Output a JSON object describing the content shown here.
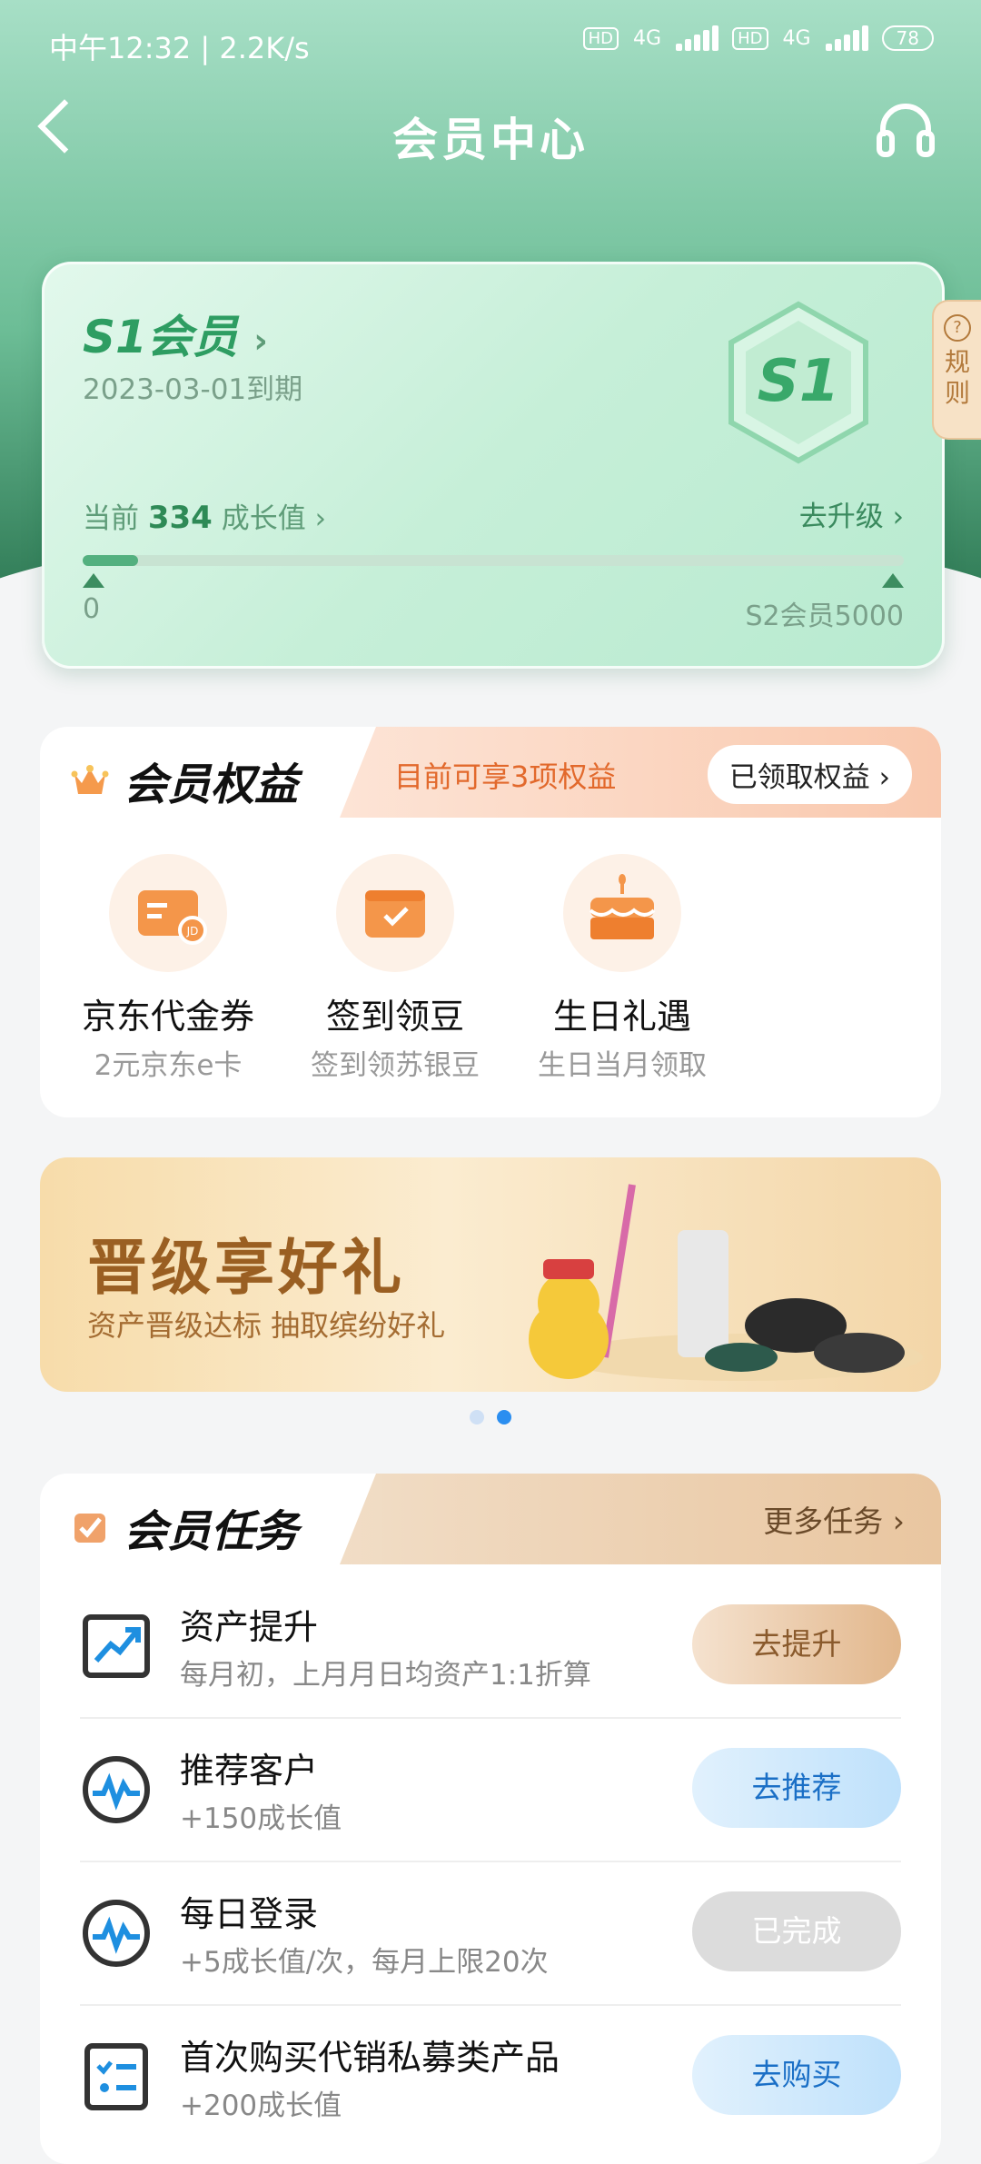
{
  "status": {
    "time": "中午12:32 | 2.2K/s",
    "net1": "4G",
    "net2": "4G",
    "battery": "78"
  },
  "header": {
    "title": "会员中心"
  },
  "card": {
    "level": "S1会员",
    "expire": "2023-03-01到期",
    "badge": "S1",
    "growth_prefix": "当前",
    "growth_value": "334",
    "growth_suffix": "成长值",
    "upgrade": "去升级",
    "progress_fraction": 0.067,
    "min": "0",
    "max": "S2会员5000"
  },
  "rules": {
    "label": "规则"
  },
  "benefits": {
    "title": "会员权益",
    "subtitle": "目前可享3项权益",
    "claimed": "已领取权益",
    "items": [
      {
        "name": "京东代金券",
        "desc": "2元京东e卡",
        "icon": "voucher-card-icon"
      },
      {
        "name": "签到领豆",
        "desc": "签到领苏银豆",
        "icon": "checkin-calendar-icon"
      },
      {
        "name": "生日礼遇",
        "desc": "生日当月领取",
        "icon": "birthday-cake-icon"
      }
    ]
  },
  "banner": {
    "title": "晋级享好礼",
    "subtitle": "资产晋级达标 抽取缤纷好礼"
  },
  "tasks": {
    "title": "会员任务",
    "more": "更多任务",
    "items": [
      {
        "name": "资产提升",
        "desc": "每月初，上月月日均资产1:1折算",
        "button": "去提升"
      },
      {
        "name": "推荐客户",
        "desc": "+150成长值",
        "button": "去推荐"
      },
      {
        "name": "每日登录",
        "desc": "+5成长值/次，每月上限20次",
        "button": "已完成"
      },
      {
        "name": "首次购买代销私募类产品",
        "desc": "+200成长值",
        "button": "去购买"
      }
    ]
  },
  "colors": {
    "brand_green": "#2e9d62",
    "benefit_orange": "#f08a3c",
    "link_blue": "#1a6fc6"
  }
}
